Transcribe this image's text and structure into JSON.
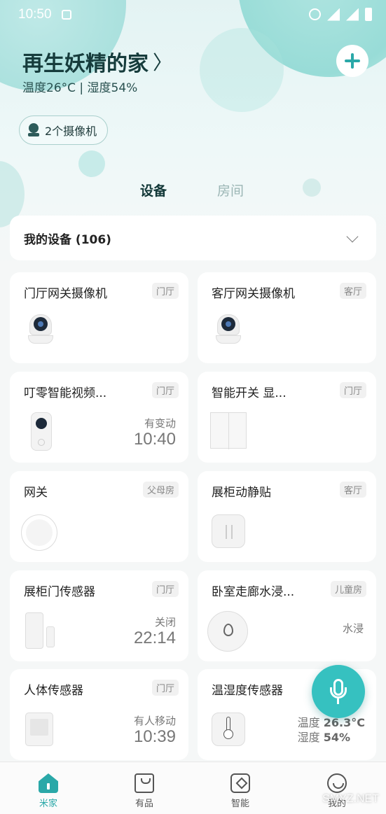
{
  "status_bar": {
    "time": "10:50"
  },
  "header": {
    "home_name": "再生妖精的家",
    "chevron": "〉",
    "environment": "温度26°C | 湿度54%",
    "cameras_label": "2个摄像机"
  },
  "tabs": [
    {
      "label": "设备",
      "active": true
    },
    {
      "label": "房间",
      "active": false
    }
  ],
  "my_devices": {
    "label": "我的设备 (106)"
  },
  "devices": [
    {
      "name": "门厅网关摄像机",
      "room": "门厅",
      "icon": "camera-icon"
    },
    {
      "name": "客厅网关摄像机",
      "room": "客厅",
      "icon": "camera-icon"
    },
    {
      "name": "叮零智能视频...",
      "room": "门厅",
      "icon": "doorbell-icon",
      "status_label": "有变动",
      "status_value": "10:40"
    },
    {
      "name": "智能开关 显...",
      "room": "门厅",
      "icon": "wall-switch-icon"
    },
    {
      "name": "网关",
      "room": "父母房",
      "icon": "gateway-icon"
    },
    {
      "name": "展柜动静贴",
      "room": "客厅",
      "icon": "vibration-sensor-icon"
    },
    {
      "name": "展柜门传感器",
      "room": "门厅",
      "icon": "door-sensor-icon",
      "status_label": "关闭",
      "status_value": "22:14"
    },
    {
      "name": "卧室走廊水浸...",
      "room": "儿童房",
      "icon": "water-sensor-icon",
      "status_label": "水浸"
    },
    {
      "name": "人体传感器",
      "room": "门厅",
      "icon": "motion-sensor-icon",
      "status_label": "有人移动",
      "status_value": "10:39"
    },
    {
      "name": "温湿度传感器",
      "room": "",
      "icon": "thermometer-icon",
      "temp_label": "温度",
      "temp_value": "26.3°C",
      "hum_label": "湿度",
      "hum_value": "54%"
    }
  ],
  "bottom_nav": [
    {
      "label": "米家",
      "icon": "home-icon",
      "active": true
    },
    {
      "label": "有品",
      "icon": "shop-icon",
      "active": false
    },
    {
      "label": "智能",
      "icon": "smart-icon",
      "active": false
    },
    {
      "label": "我的",
      "icon": "profile-icon",
      "active": false
    }
  ],
  "watermark": "SMYZ.NET",
  "colors": {
    "accent": "#2aa8a8",
    "mic_button": "#36c1c0",
    "title": "#163c3c"
  }
}
